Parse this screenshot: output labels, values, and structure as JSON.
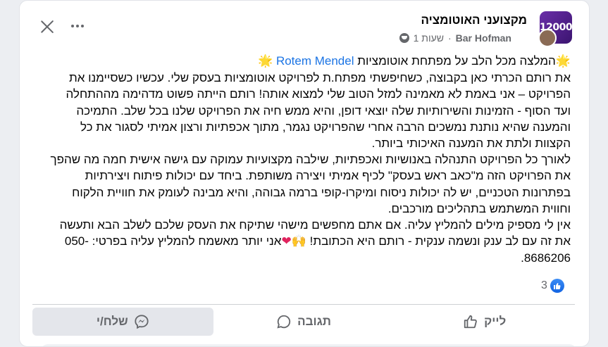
{
  "post": {
    "group_name": "מקצועני האוטומציה",
    "avatar_text": "12000",
    "author": "Bar Hofman",
    "time": "1 שעות",
    "separator": "·",
    "mention": "Rotem Mendel",
    "lines": {
      "l1_prefix": "המלצה מכל הלב על מפתחת אוטומציות",
      "p1": "את רותם הכרתי כאן בקבוצה, כשחיפשתי מפתח.ת לפרויקט אוטומציות בעסק שלי. עכשיו כשסיימנו את הפרויקט – אני באמת לא מאמינה למזל הטוב שלי למצוא אותה! רותם הייתה פשוט מדהימה מההתחלה ועד הסוף - הזמינות והשירותיות שלה יוצאי דופן, והיא ממש חיה את הפרויקט שלנו בכל שלב. התמיכה והמענה שהיא נותנת נמשכים הרבה אחרי שהפרויקט נגמר, מתוך אכפתיות ורצון אמיתי לסגור את כל הקצוות ולתת את המענה האיכותי ביותר.",
      "p2": "לאורך כל הפרויקט התנהלה באנושיות ואכפתיות, שילבה מקצועיות עמוקה עם גישה אישית חמה מה שהפך את הפרויקט הזה מ\"כאב ראש בעסק\" לכיף אמיתי ויצירה משותפת. ביחד עם יכולות פיתוח ויצירתיות בפתרונות הטכניים, יש לה יכולות ניסוח ומיקרו-קופי ברמה גבוהה, והיא מבינה לעומק את חוויית הלקוח וחווית המשתמש בתהליכים מורכבים.",
      "p3_a": "אין לי מספיק מילים להמליץ עליה. אם אתם מחפשים מישהי שתיקח את העסק שלכם לשלב הבא ותעשה את זה עם לב ענק ונשמה ענקית - רותם היא הכתובת!",
      "p3_b": "אני יותר מאשמח להמליץ עליה בפרטי: 050-8686206."
    },
    "emoji": {
      "star": "🌟",
      "hands": "🙌",
      "heart": "❤"
    },
    "reaction_count": "3",
    "actions": {
      "like": "לייק",
      "comment": "תגובה",
      "send": "שלח/י"
    },
    "colors": {
      "mention": "#1b74e4",
      "like_badge": "#1877f2",
      "active_action_bg": "#e4e6eb"
    }
  }
}
